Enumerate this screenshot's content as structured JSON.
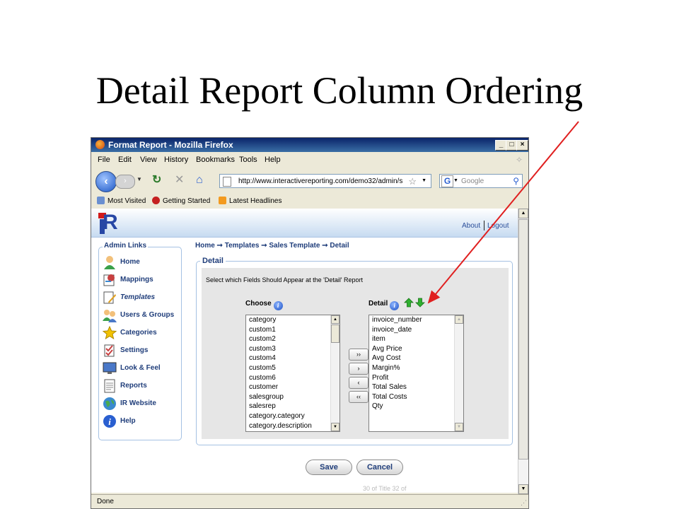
{
  "slide": {
    "title": "Detail Report Column Ordering"
  },
  "window": {
    "title": "Format Report - Mozilla Firefox",
    "controls": {
      "minimize": "_",
      "maximize": "□",
      "close": "×"
    }
  },
  "menu": [
    "File",
    "Edit",
    "View",
    "History",
    "Bookmarks",
    "Tools",
    "Help"
  ],
  "navbar": {
    "back_icon": "back-arrow-icon",
    "forward_icon": "forward-arrow-icon",
    "url": "http://www.interactivereporting.com/demo32/admin/s",
    "search_placeholder": "Google"
  },
  "bookmarks": [
    {
      "label": "Most Visited",
      "icon": "most-visited-icon"
    },
    {
      "label": "Getting Started",
      "icon": "getting-started-icon"
    },
    {
      "label": "Latest Headlines",
      "icon": "rss-icon"
    }
  ],
  "header": {
    "about": "About",
    "logout": "Logout"
  },
  "admin_links": {
    "title": "Admin Links",
    "items": [
      {
        "label": "Home",
        "icon": "home-user-icon",
        "color": "#3aa04a"
      },
      {
        "label": "Mappings",
        "icon": "mappings-icon",
        "color": "#c74040"
      },
      {
        "label": "Templates",
        "icon": "templates-icon",
        "color": "#e0a020"
      },
      {
        "label": "Users & Groups",
        "icon": "users-icon",
        "color": "#3aa04a"
      },
      {
        "label": "Categories",
        "icon": "star-icon",
        "color": "#f2c200"
      },
      {
        "label": "Settings",
        "icon": "settings-icon",
        "color": "#c74040"
      },
      {
        "label": "Look & Feel",
        "icon": "monitor-icon",
        "color": "#4a78c8"
      },
      {
        "label": "Reports",
        "icon": "report-icon",
        "color": "#666666"
      },
      {
        "label": "IR Website",
        "icon": "globe-icon",
        "color": "#3a8ad0"
      },
      {
        "label": "Help",
        "icon": "help-icon",
        "color": "#2a5fd0"
      }
    ]
  },
  "breadcrumb": "Home ➞ Templates ➞ Sales Template ➞ Detail",
  "detail": {
    "legend": "Detail",
    "instruction": "Select which Fields Should Appear at the 'Detail' Report",
    "choose_label": "Choose",
    "detail_label": "Detail",
    "choose_items": [
      "category",
      "custom1",
      "custom2",
      "custom3",
      "custom4",
      "custom5",
      "custom6",
      "customer",
      "salesgroup",
      "salesrep",
      "category.category",
      "category.description"
    ],
    "detail_items": [
      "invoice_number",
      "invoice_date",
      "item",
      "Avg Price",
      "Avg Cost",
      "Margin%",
      "Profit",
      "Total Sales",
      "Total Costs",
      "Qty"
    ],
    "move_buttons": {
      "add_all": "››",
      "add": "›",
      "remove": "‹",
      "remove_all": "‹‹"
    }
  },
  "actions": {
    "save": "Save",
    "cancel": "Cancel"
  },
  "footer_ghost": "30 of Title 32 of",
  "status": "Done",
  "accent": {
    "pointer_arrow": "#e02020",
    "link_blue": "#1f3d7a"
  }
}
